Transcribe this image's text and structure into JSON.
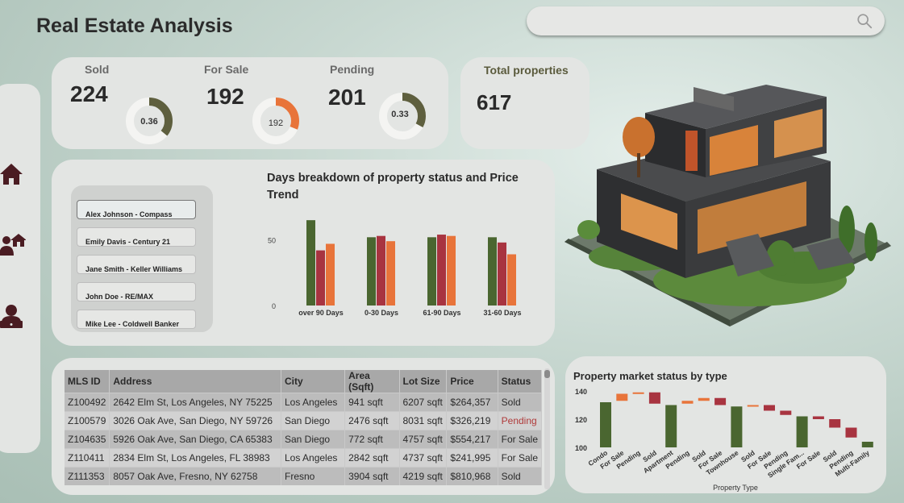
{
  "header": {
    "title": "Real Estate Analysis",
    "search_placeholder": ""
  },
  "sidebar": {
    "items": [
      {
        "icon": "home-icon"
      },
      {
        "icon": "agents-home-icon"
      },
      {
        "icon": "agent-laptop-icon"
      }
    ]
  },
  "kpis": {
    "sold": {
      "label": "Sold",
      "value": "224",
      "donut": "0.36",
      "fraction": 0.36,
      "color": "#5e5f3e"
    },
    "for_sale": {
      "label": "For Sale",
      "value": "192",
      "donut": "192",
      "fraction": 0.31,
      "color": "#e8743a"
    },
    "pending": {
      "label": "Pending",
      "value": "201",
      "donut": "0.33",
      "fraction": 0.33,
      "color": "#5e5f3e"
    },
    "total": {
      "label": "Total properties",
      "value": "617"
    }
  },
  "agents": [
    "Alex Johnson - Compass",
    "Emily Davis - Century 21",
    "Jane Smith - Keller Williams",
    "John Doe - RE/MAX",
    "Mike Lee - Coldwell Banker"
  ],
  "days_chart": {
    "title_line1": "Days breakdown of property status and Price",
    "title_line2": "Trend"
  },
  "market_chart": {
    "title": "Property market status by type"
  },
  "table": {
    "headers": [
      "MLS ID",
      "Address",
      "City",
      "Area (Sqft)",
      "Lot Size",
      "Price",
      "Status"
    ],
    "rows": [
      [
        "Z100492",
        "2642 Elm St, Los Angeles, NY 75225",
        "Los Angeles",
        "941 sqft",
        "6207 sqft",
        "$264,357",
        "Sold"
      ],
      [
        "Z100579",
        "3026 Oak Ave, San Diego, NY 59726",
        "San Diego",
        "2476 sqft",
        "8031 sqft",
        "$326,219",
        "Pending"
      ],
      [
        "Z104635",
        "5926 Oak Ave, San Diego, CA 65383",
        "San Diego",
        "772 sqft",
        "4757 sqft",
        "$554,217",
        "For Sale"
      ],
      [
        "Z110411",
        "2834 Elm St, Los Angeles, FL 38983",
        "Los Angeles",
        "2842 sqft",
        "4737 sqft",
        "$241,995",
        "For Sale"
      ],
      [
        "Z111353",
        "8057 Oak Ave, Fresno, NY 62758",
        "Fresno",
        "3904 sqft",
        "4219 sqft",
        "$810,968",
        "Sold"
      ]
    ]
  },
  "chart_data": [
    {
      "type": "bar",
      "title": "Days breakdown of property status and Price Trend",
      "categories": [
        "over 90 Days",
        "0-30 Days",
        "61-90 Days",
        "31-60 Days"
      ],
      "yticks": [
        0,
        50
      ],
      "ylim": [
        0,
        70
      ],
      "grid": false,
      "colors": [
        "#4a6630",
        "#a83440",
        "#e8743a"
      ],
      "series": [
        {
          "values": [
            65,
            52,
            52,
            52
          ]
        },
        {
          "values": [
            42,
            53,
            54,
            48
          ]
        },
        {
          "values": [
            47,
            49,
            53,
            39
          ]
        }
      ]
    },
    {
      "type": "waterfall",
      "title": "Property market status by type",
      "xlabel": "Property Type",
      "yticks": [
        100,
        120,
        140
      ],
      "ylim": [
        100,
        140
      ],
      "grid": false,
      "colors": {
        "total": "#4a6630",
        "increase": "#e8743a",
        "decrease": "#a83440"
      },
      "categories": [
        "Condo",
        "For Sale",
        "Pending",
        "Sold",
        "Apartment",
        "Pending",
        "Sold",
        "For Sale",
        "Townhouse",
        "Sold",
        "For Sale",
        "Pending",
        "Single Fam...",
        "For Sale",
        "Sold",
        "Pending",
        "Multi-Family"
      ],
      "bars": [
        {
          "kind": "total",
          "start": 100,
          "end": 132
        },
        {
          "kind": "increase",
          "start": 133,
          "end": 138
        },
        {
          "kind": "increase",
          "start": 138,
          "end": 139
        },
        {
          "kind": "decrease",
          "start": 139,
          "end": 131
        },
        {
          "kind": "total",
          "start": 100,
          "end": 130
        },
        {
          "kind": "increase",
          "start": 131,
          "end": 133
        },
        {
          "kind": "increase",
          "start": 133,
          "end": 135
        },
        {
          "kind": "decrease",
          "start": 135,
          "end": 130
        },
        {
          "kind": "total",
          "start": 100,
          "end": 129
        },
        {
          "kind": "increase",
          "start": 129,
          "end": 130
        },
        {
          "kind": "decrease",
          "start": 130,
          "end": 126
        },
        {
          "kind": "decrease",
          "start": 126,
          "end": 123
        },
        {
          "kind": "total",
          "start": 100,
          "end": 122
        },
        {
          "kind": "decrease",
          "start": 122,
          "end": 120
        },
        {
          "kind": "decrease",
          "start": 120,
          "end": 114
        },
        {
          "kind": "decrease",
          "start": 114,
          "end": 107
        },
        {
          "kind": "total",
          "start": 100,
          "end": 104
        }
      ]
    }
  ]
}
